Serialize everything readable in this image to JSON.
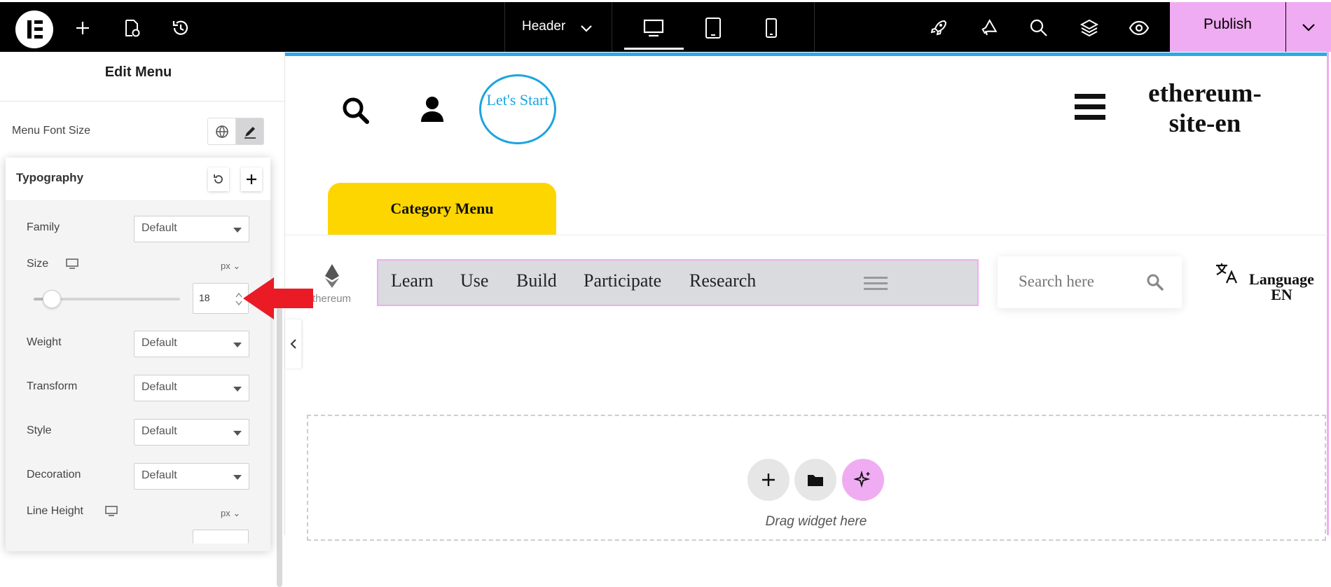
{
  "topbar": {
    "document_label": "Header",
    "publish_label": "Publish",
    "icons": [
      "elementor-logo-icon",
      "add-icon",
      "page-settings-icon",
      "history-icon",
      "chevron-down-icon",
      "desktop-icon",
      "tablet-icon",
      "mobile-icon",
      "rocket-icon",
      "megaphone-icon",
      "search-icon",
      "layers-icon",
      "eye-icon"
    ],
    "accent_color": "#f0acf2"
  },
  "panel": {
    "title": "Edit Menu",
    "menu_font_size_label": "Menu Font Size",
    "typography": {
      "title": "Typography",
      "family_label": "Family",
      "family_value": "Default",
      "size_label": "Size",
      "size_unit": "px",
      "size_value": "18",
      "weight_label": "Weight",
      "weight_value": "Default",
      "transform_label": "Transform",
      "transform_value": "Default",
      "style_label": "Style",
      "style_value": "Default",
      "decoration_label": "Decoration",
      "decoration_value": "Default",
      "line_height_label": "Line Height",
      "line_height_unit": "px"
    }
  },
  "canvas": {
    "lets_start": "Let's Start",
    "site_title_line1": "ethereum-",
    "site_title_line2": "site-en",
    "category_menu": "Category Menu",
    "logo_text": "thereum",
    "menu_items": [
      "Learn",
      "Use",
      "Build",
      "Participate",
      "Research"
    ],
    "search_placeholder": "Search here",
    "language_label": "Language",
    "language_value": "EN",
    "drag_widget": "Drag widget here",
    "accent_blue": "#2ea8e8",
    "category_color": "#fdd600"
  }
}
